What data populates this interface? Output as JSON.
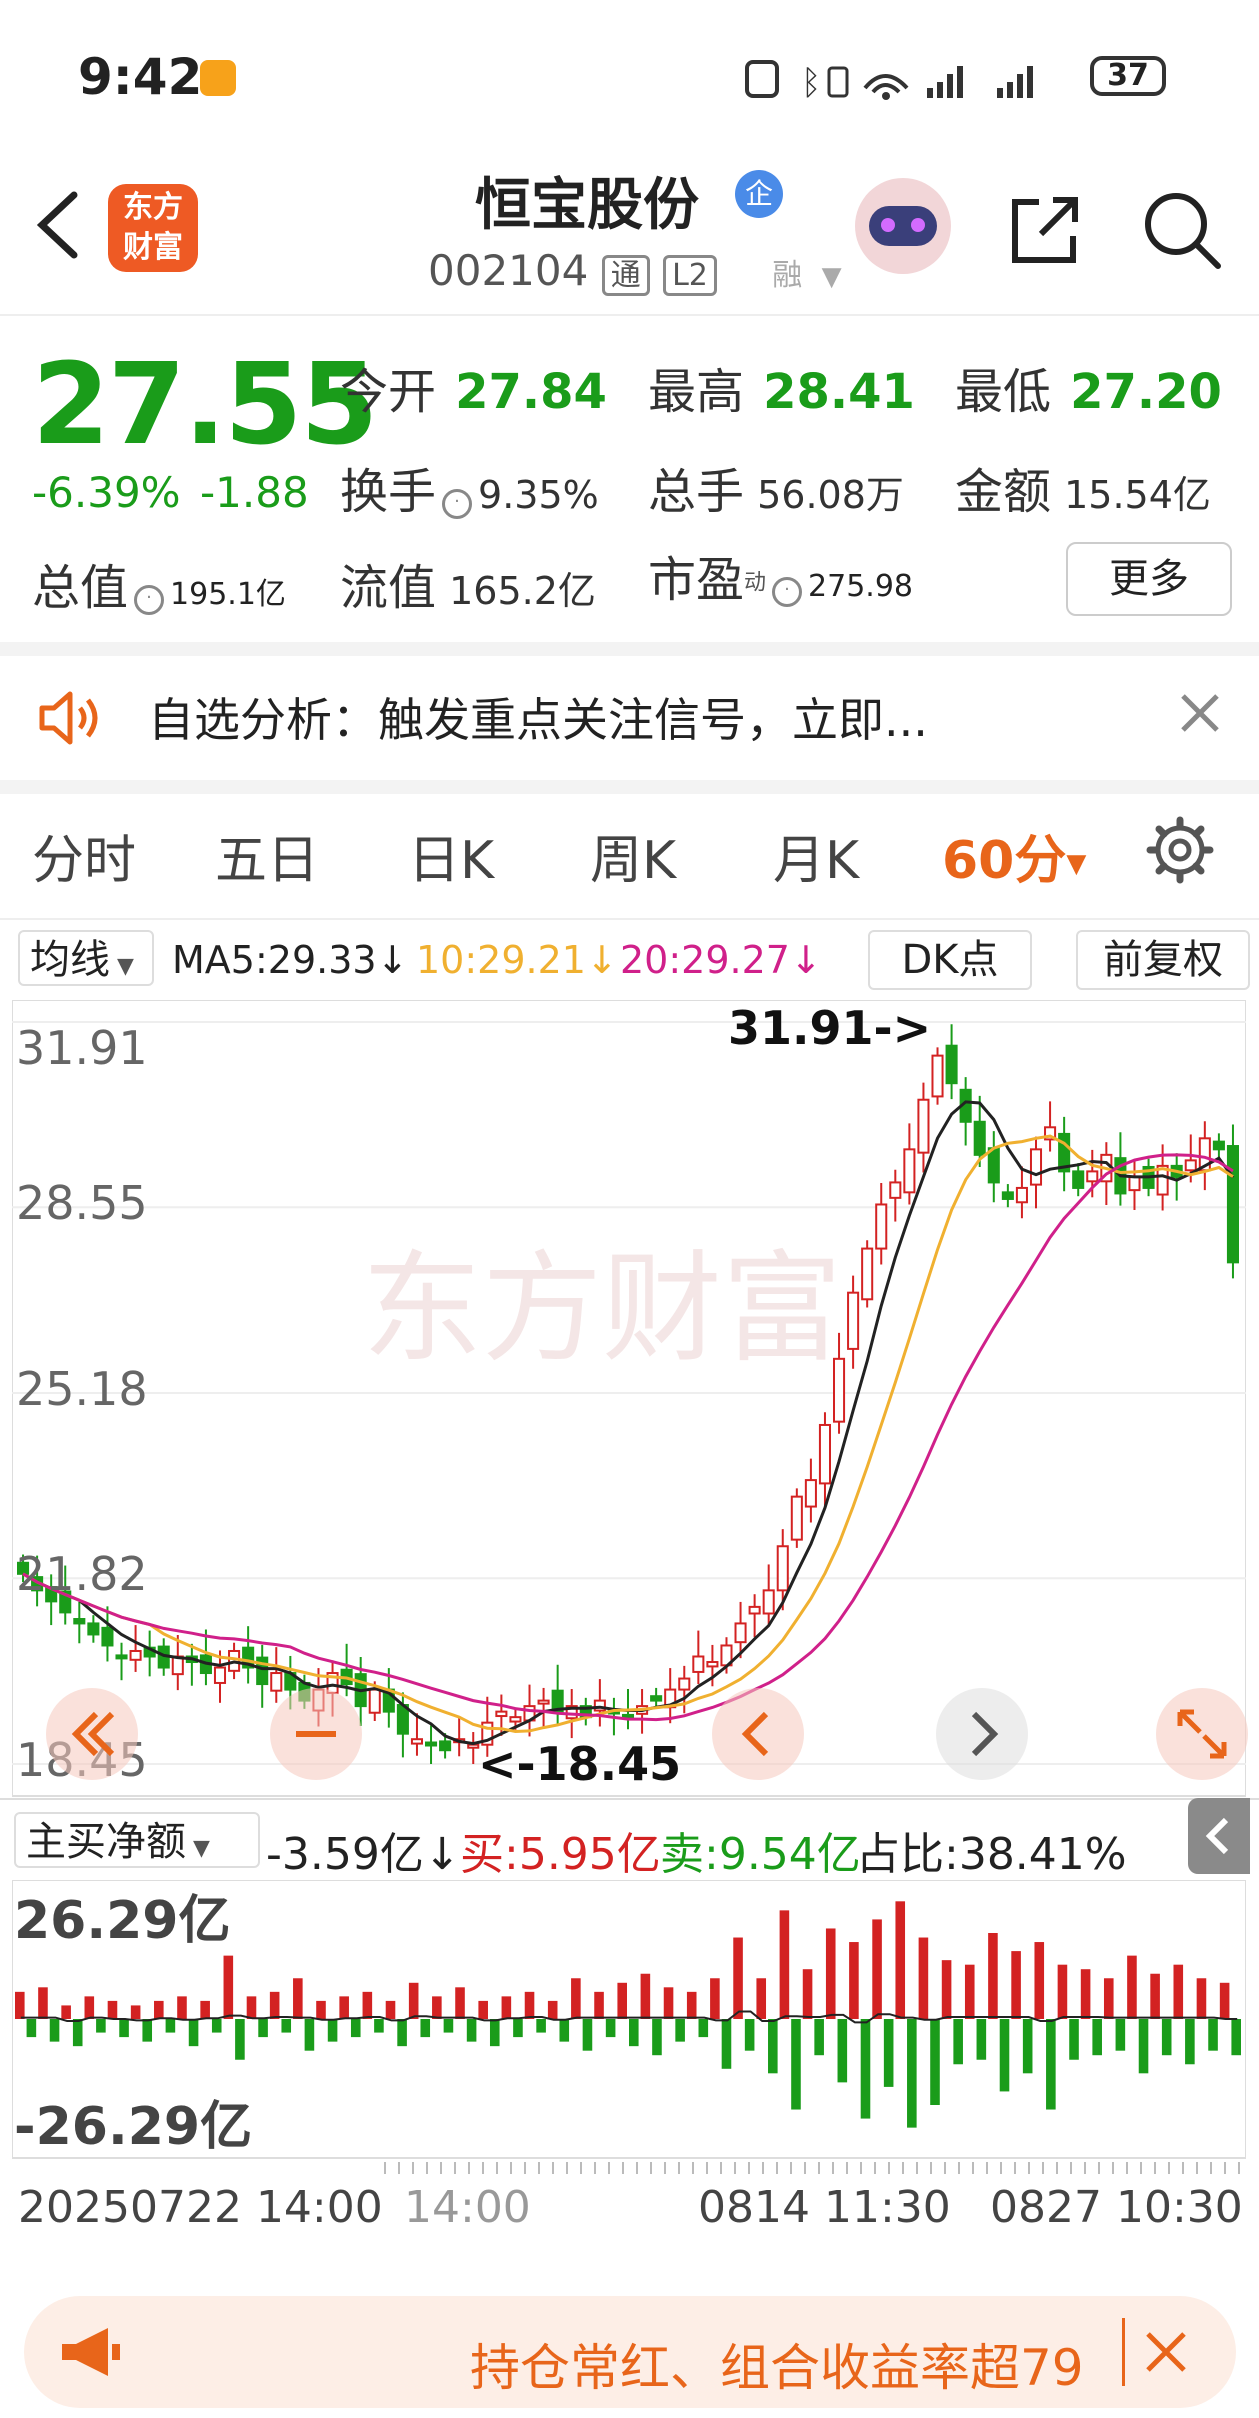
{
  "status": {
    "time": "9:42",
    "battery": "37"
  },
  "header": {
    "name": "恒宝股份",
    "badge": "企",
    "code": "002104",
    "tag1": "通",
    "tag2": "L2",
    "tag3": "融",
    "logo": [
      "东方",
      "财富"
    ]
  },
  "quote": {
    "price": "27.55",
    "pct": "-6.39%",
    "change": "-1.88",
    "open_label": "今开",
    "open": "27.84",
    "high_label": "最高",
    "high": "28.41",
    "low_label": "最低",
    "low": "27.20",
    "turnover_label": "换手",
    "turnover": "9.35%",
    "volume_label": "总手",
    "volume": "56.08万",
    "amount_label": "金额",
    "amount": "15.54亿",
    "mktcap_label": "总值",
    "mktcap": "195.1亿",
    "float_label": "流值",
    "float": "165.2亿",
    "pe_label": "市盈",
    "pe_sup": "动",
    "pe": "275.98",
    "more": "更多"
  },
  "alert": {
    "text": "自选分析：触发重点关注信号，立即..."
  },
  "tabs": [
    "分时",
    "五日",
    "日K",
    "周K",
    "月K",
    "60分"
  ],
  "ma": {
    "selector": "均线",
    "ma5": "MA5:29.33↓",
    "ma10": "10:29.21↓",
    "ma20": "20:29.27↓",
    "dk": "DK点",
    "adjust": "前复权",
    "colors": {
      "ma5": "#222222",
      "ma10": "#f0b030",
      "ma20": "#d0208a",
      "up": "#d32222",
      "down": "#1a9c1a"
    }
  },
  "kchart": {
    "yticks": [
      "31.91",
      "28.55",
      "25.18",
      "21.82",
      "18.45"
    ],
    "max_label": "31.91->",
    "min_label": "<-18.45"
  },
  "flow": {
    "selector": "主买净额",
    "net": "-3.59亿↓",
    "buy": "买:5.95亿",
    "sell": "卖:9.54亿",
    "ratio": "占比:38.41%",
    "ymax": "26.29亿",
    "ymin": "-26.29亿"
  },
  "xlabels": [
    "20250722 14:00",
    "14:00",
    "0814 11:30",
    "0827 10:30"
  ],
  "banner": {
    "text": "持仓常红、组合收益率超79"
  },
  "chart_data": [
    {
      "type": "candlestick",
      "ylim": [
        18.45,
        31.91
      ],
      "yticks": [
        31.91,
        28.55,
        25.18,
        21.82,
        18.45
      ],
      "series": [
        {
          "name": "MA5",
          "value": 29.33
        },
        {
          "name": "MA10",
          "value": 29.21
        },
        {
          "name": "MA20",
          "value": 29.27
        }
      ],
      "close": [
        21.9,
        21.6,
        21.4,
        21.2,
        21.0,
        20.8,
        20.6,
        20.4,
        20.5,
        20.4,
        20.2,
        20.4,
        20.3,
        20.1,
        20.2,
        20.5,
        20.2,
        19.9,
        20.1,
        19.8,
        19.6,
        19.8,
        20.1,
        19.9,
        19.5,
        19.8,
        19.4,
        19.0,
        18.9,
        18.8,
        18.7,
        18.9,
        18.8,
        19.2,
        19.4,
        19.3,
        19.5,
        19.6,
        19.4,
        19.5,
        19.3,
        19.6,
        19.4,
        19.3,
        19.5,
        19.6,
        19.8,
        20.0,
        20.4,
        20.3,
        20.6,
        21.0,
        21.3,
        21.6,
        22.4,
        23.3,
        23.6,
        24.6,
        25.8,
        27.0,
        27.8,
        28.6,
        29.0,
        29.6,
        30.5,
        31.3,
        30.8,
        30.1,
        29.5,
        29.0,
        28.7,
        28.9,
        29.6,
        30.0,
        29.2,
        28.9,
        29.2,
        29.5,
        28.8,
        29.1,
        28.9,
        29.3,
        29.1,
        29.4,
        29.8,
        29.6,
        27.55
      ]
    },
    {
      "type": "bar",
      "name": "主买净额",
      "ylim": [
        -26.29,
        26.29
      ],
      "values": [
        6,
        -4,
        7,
        -5,
        3,
        -6,
        5,
        -3,
        4,
        -4,
        3,
        -5,
        4,
        -3,
        5,
        -6,
        4,
        -3,
        14,
        -9,
        5,
        -4,
        6,
        -3,
        9,
        -7,
        4,
        -5,
        5,
        -4,
        6,
        -3,
        4,
        -6,
        8,
        -4,
        5,
        -3,
        7,
        -5,
        4,
        -6,
        5,
        -4,
        6,
        -3,
        4,
        -5,
        9,
        -7,
        6,
        -4,
        8,
        -6,
        10,
        -8,
        7,
        -5,
        6,
        -4,
        9,
        -11,
        18,
        -7,
        9,
        -12,
        24,
        -20,
        11,
        -8,
        20,
        -14,
        17,
        -22,
        22,
        -15,
        26,
        -24,
        18,
        -19,
        13,
        -10,
        12,
        -9,
        19,
        -16,
        15,
        -12,
        17,
        -20,
        12,
        -9,
        11,
        -8,
        9,
        -7,
        14,
        -12,
        10,
        -8,
        12,
        -10,
        9,
        -7,
        8,
        -8
      ]
    }
  ]
}
